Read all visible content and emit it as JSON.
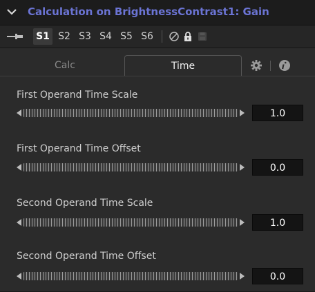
{
  "header": {
    "title": "Calculation on BrightnessContrast1: Gain",
    "title_color": "#6b74d4",
    "collapse_icon": "chevron-down-icon"
  },
  "toolbar": {
    "pin_icon": "pin-icon",
    "version_buttons": [
      {
        "label": "S1",
        "active": true
      },
      {
        "label": "S2",
        "active": false
      },
      {
        "label": "S3",
        "active": false
      },
      {
        "label": "S4",
        "active": false
      },
      {
        "label": "S5",
        "active": false
      },
      {
        "label": "S6",
        "active": false
      }
    ],
    "icons": [
      "disable-icon",
      "lock-icon",
      "save-icon"
    ]
  },
  "tabs": {
    "items": [
      {
        "label": "Calc",
        "active": false
      },
      {
        "label": "Time",
        "active": true
      }
    ],
    "icons": [
      "gear-icon",
      "info-icon"
    ]
  },
  "controls": [
    {
      "label": "First Operand Time Scale",
      "value": "1.0"
    },
    {
      "label": "First Operand Time Offset",
      "value": "0.0"
    },
    {
      "label": "Second Operand Time Scale",
      "value": "1.0"
    },
    {
      "label": "Second Operand Time Offset",
      "value": "0.0"
    }
  ]
}
